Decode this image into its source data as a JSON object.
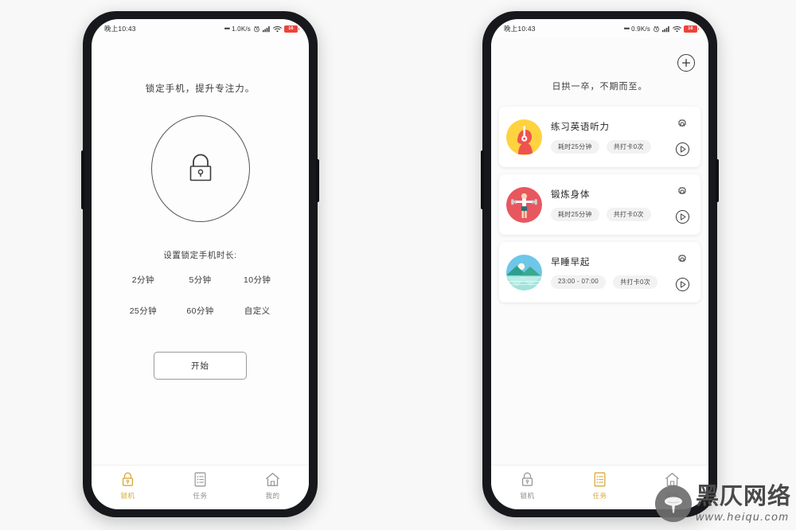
{
  "meta": {
    "background_color": "#f8f8f8",
    "phone_frame_color": "#17181c",
    "accent_color": "#d9a93a"
  },
  "status_bar": {
    "time": "晚上10:43",
    "dots": "•••",
    "left_speed": "1.0K/s",
    "right_speed": "0.9K/s",
    "battery_text": "16",
    "battery_color": "#e8453c"
  },
  "lock_screen": {
    "slogan": "锁定手机，提升专注力。",
    "lock_icon_name": "padlock-icon",
    "duration_title": "设置锁定手机时长:",
    "duration_options": [
      "2分钟",
      "5分钟",
      "10分钟",
      "25分钟",
      "60分钟",
      "自定义"
    ],
    "start_button": "开始"
  },
  "task_screen": {
    "add_button_icon": "plus-circle-icon",
    "slogan": "日拱一卒，不期而至。",
    "cards": [
      {
        "title": "练习英语听力",
        "icon": "headphone-head-icon",
        "icon_bg": "#ffd23f",
        "icon_fg": "#ef5350",
        "tags": [
          "耗时25分钟",
          "共打卡0次"
        ],
        "settings_icon": "gear-icon",
        "play_icon": "play-circle-icon"
      },
      {
        "title": "锻炼身体",
        "icon": "weightlifter-icon",
        "icon_bg": "#e8575f",
        "icon_fg": "#ffffff",
        "tags": [
          "耗时25分钟",
          "共打卡0次"
        ],
        "settings_icon": "gear-icon",
        "play_icon": "play-circle-icon"
      },
      {
        "title": "早睡早起",
        "icon": "sunrise-landscape-icon",
        "icon_bg": "#6ec6e8",
        "icon_fg": "#2f9e8f",
        "tags": [
          "23:00 - 07:00",
          "共打卡0次"
        ],
        "settings_icon": "gear-icon",
        "play_icon": "play-circle-icon"
      }
    ]
  },
  "tabbar": {
    "tabs": [
      {
        "label": "锁机",
        "icon": "lock-icon"
      },
      {
        "label": "任务",
        "icon": "list-icon"
      },
      {
        "label": "我的",
        "icon": "home-icon"
      }
    ],
    "left_phone_active_index": 0,
    "right_phone_active_index": 1
  },
  "watermark": {
    "cn": "黑仄网络",
    "url": "www.heiqu.com",
    "logo_icon": "mushroom-logo-icon"
  }
}
